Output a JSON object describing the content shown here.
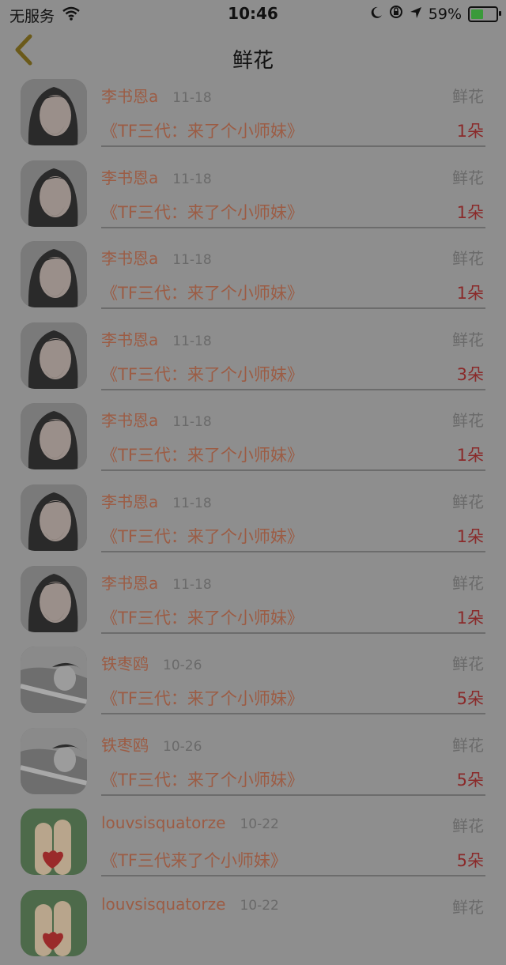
{
  "status_bar": {
    "carrier": "无服务",
    "time": "10:46",
    "battery": "59%",
    "battery_level": 0.59
  },
  "nav": {
    "title": "鲜花"
  },
  "rows": [
    {
      "name": "李书恩a",
      "date": "11-18",
      "type": "鲜花",
      "book": "《TF三代：来了个小师妹》",
      "count": "1朵",
      "avatar": "girl-photo"
    },
    {
      "name": "李书恩a",
      "date": "11-18",
      "type": "鲜花",
      "book": "《TF三代：来了个小师妹》",
      "count": "1朵",
      "avatar": "girl-photo"
    },
    {
      "name": "李书恩a",
      "date": "11-18",
      "type": "鲜花",
      "book": "《TF三代：来了个小师妹》",
      "count": "1朵",
      "avatar": "girl-photo"
    },
    {
      "name": "李书恩a",
      "date": "11-18",
      "type": "鲜花",
      "book": "《TF三代：来了个小师妹》",
      "count": "3朵",
      "avatar": "girl-photo"
    },
    {
      "name": "李书恩a",
      "date": "11-18",
      "type": "鲜花",
      "book": "《TF三代：来了个小师妹》",
      "count": "1朵",
      "avatar": "girl-photo"
    },
    {
      "name": "李书恩a",
      "date": "11-18",
      "type": "鲜花",
      "book": "《TF三代：来了个小师妹》",
      "count": "1朵",
      "avatar": "girl-photo"
    },
    {
      "name": "李书恩a",
      "date": "11-18",
      "type": "鲜花",
      "book": "《TF三代：来了个小师妹》",
      "count": "1朵",
      "avatar": "girl-photo"
    },
    {
      "name": "铁枣鸥",
      "date": "10-26",
      "type": "鲜花",
      "book": "《TF三代：来了个小师妹》",
      "count": "5朵",
      "avatar": "bw-photo"
    },
    {
      "name": "铁枣鸥",
      "date": "10-26",
      "type": "鲜花",
      "book": "《TF三代：来了个小师妹》",
      "count": "5朵",
      "avatar": "bw-photo"
    },
    {
      "name": "louvsisquatorze",
      "date": "10-22",
      "type": "鲜花",
      "book": "《TF三代来了个小师妹》",
      "count": "5朵",
      "avatar": "fingers-photo"
    },
    {
      "name": "louvsisquatorze",
      "date": "10-22",
      "type": "鲜花",
      "book": "",
      "count": "",
      "avatar": "fingers-photo"
    }
  ]
}
